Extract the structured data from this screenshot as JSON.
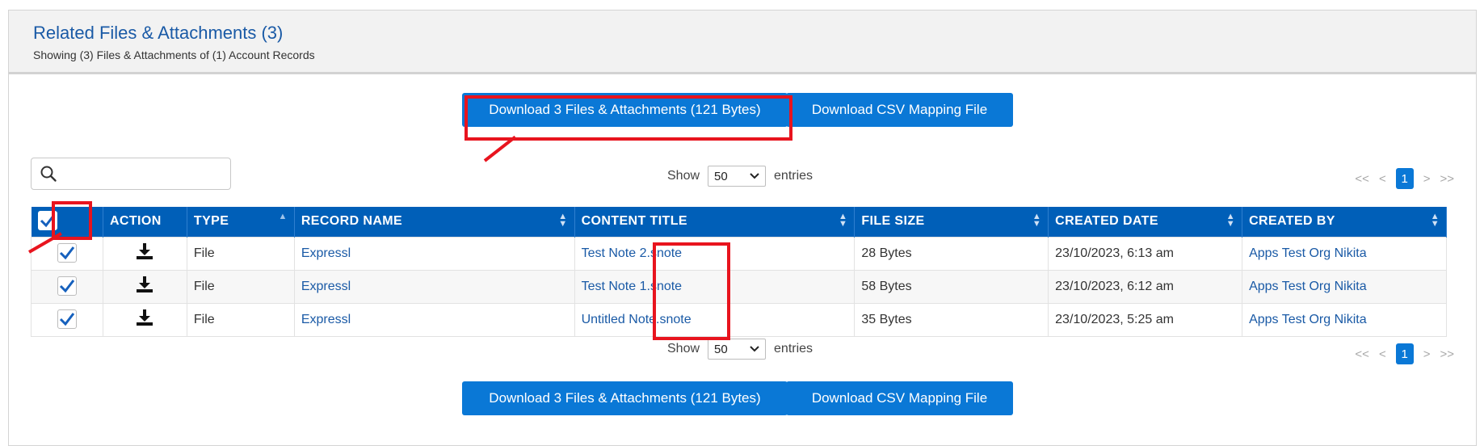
{
  "header": {
    "title": "Related Files & Attachments (3)",
    "subtitle": "Showing (3) Files & Attachments of (1) Account Records"
  },
  "actions": {
    "download_label": "Download 3 Files & Attachments (121 Bytes)",
    "csv_label": "Download CSV Mapping File"
  },
  "search": {
    "value": "",
    "placeholder": ""
  },
  "entries": {
    "show_label": "Show",
    "value": "50",
    "entries_label": "entries"
  },
  "pager": {
    "first": "<<",
    "prev": "<",
    "current": "1",
    "next": ">",
    "last": ">>"
  },
  "table": {
    "columns": [
      "ACTION",
      "TYPE",
      "RECORD NAME",
      "CONTENT TITLE",
      "FILE SIZE",
      "CREATED DATE",
      "CREATED BY"
    ],
    "rows": [
      {
        "type": "File",
        "record_name": "Expressl",
        "content_title": "Test Note 2.snote",
        "file_size": "28 Bytes",
        "created_date": "23/10/2023, 6:13 am",
        "created_by": "Apps Test Org Nikita"
      },
      {
        "type": "File",
        "record_name": "Expressl",
        "content_title": "Test Note 1.snote",
        "file_size": "58 Bytes",
        "created_date": "23/10/2023, 6:12 am",
        "created_by": "Apps Test Org Nikita"
      },
      {
        "type": "File",
        "record_name": "Expressl",
        "content_title": "Untitled Note.snote",
        "file_size": "35 Bytes",
        "created_date": "23/10/2023, 5:25 am",
        "created_by": "Apps Test Org Nikita"
      }
    ]
  },
  "colors": {
    "accent": "#0a78d6",
    "header_bg": "#005fb8",
    "link": "#1a5aa6",
    "annotation": "#e8141e"
  }
}
